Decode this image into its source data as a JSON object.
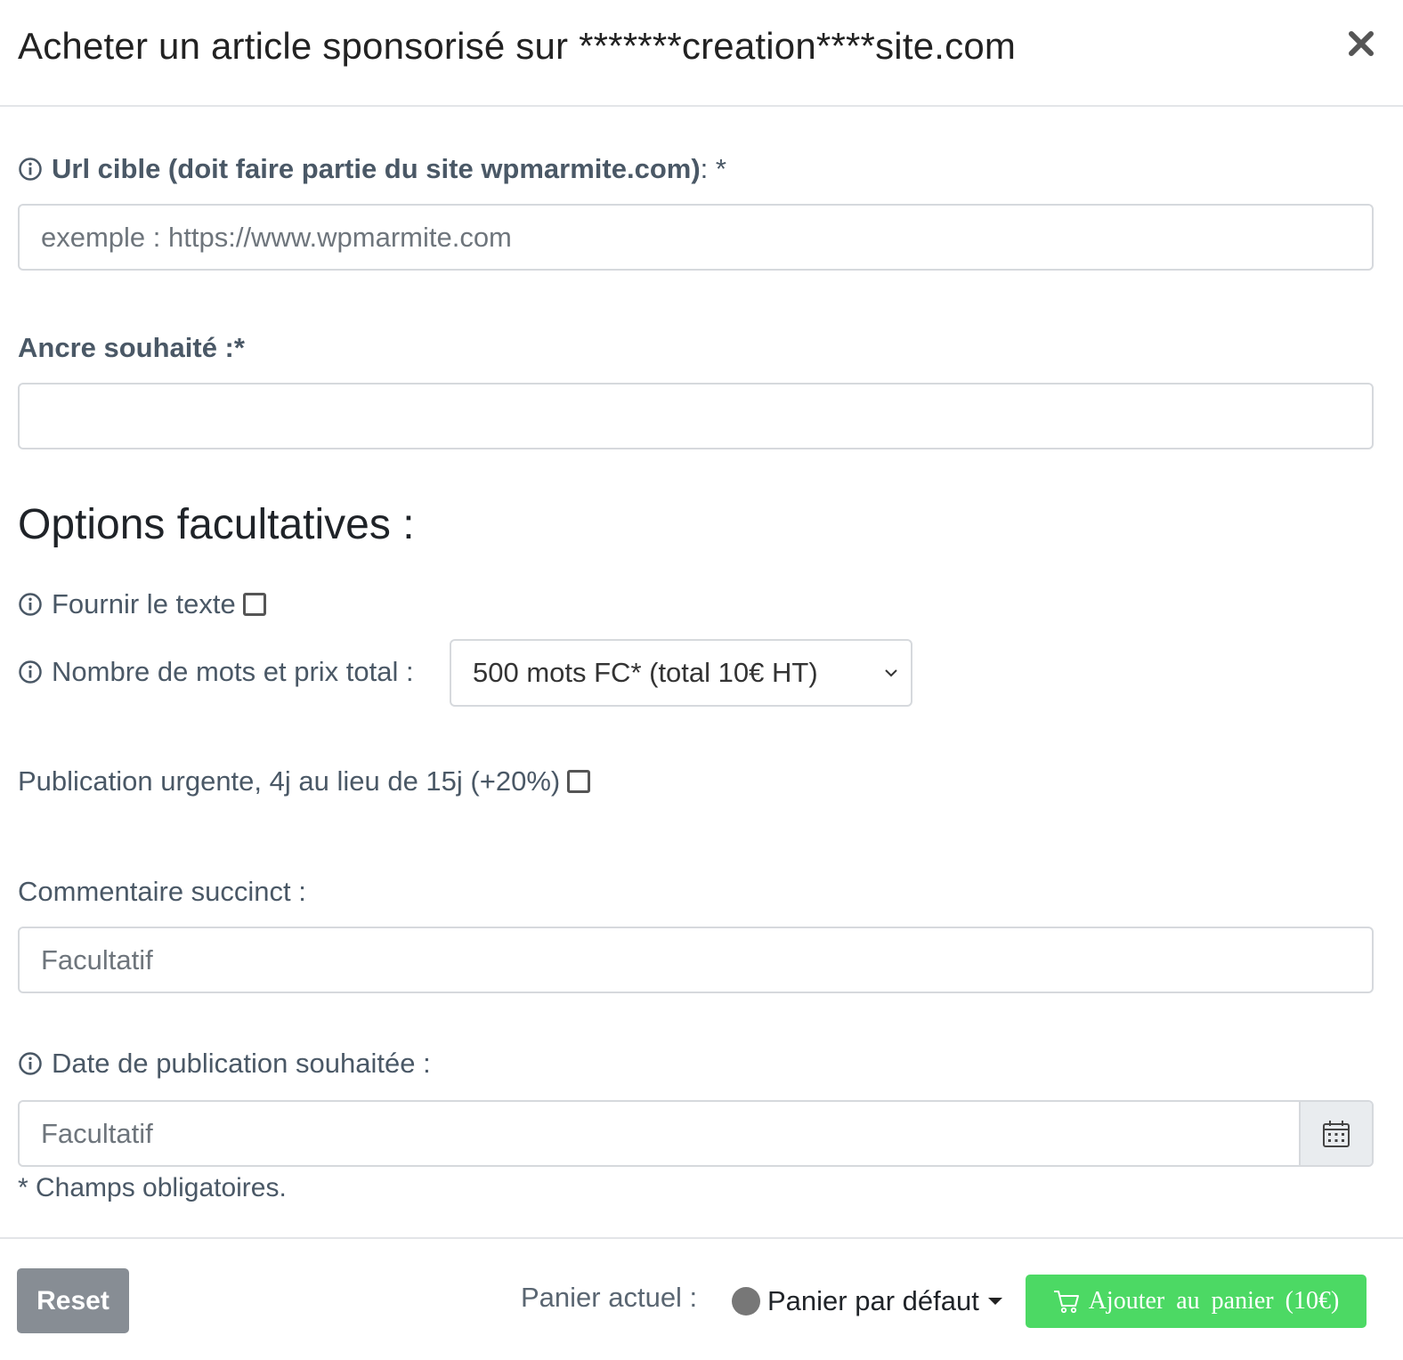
{
  "modal": {
    "title": "Acheter un article sponsorisé sur *******creation****site.com"
  },
  "form": {
    "url_label": "Url cible (doit faire partie du site wpmarmite.com)",
    "url_label_suffix": " : *",
    "url_placeholder": "exemple : https://www.wpmarmite.com",
    "anchor_label": "Ancre souhaité :",
    "anchor_label_suffix": " *",
    "options_title": "Options facultatives :",
    "provide_text_label": "Fournir le texte",
    "word_count_label": "Nombre de mots et prix total :",
    "word_count_selected": "500 mots FC* (total 10€ HT)",
    "urgent_label": "Publication urgente, 4j au lieu de 15j (+20%)",
    "comment_label": "Commentaire succinct :",
    "comment_placeholder": "Facultatif",
    "date_label": "Date de publication souhaitée :",
    "date_placeholder": "Facultatif",
    "required_note": "* Champs obligatoires."
  },
  "footer": {
    "reset_label": "Reset",
    "cart_label": "Panier actuel :",
    "cart_selected": "Panier par défaut",
    "add_to_cart_label": "Ajouter au panier (10€)"
  },
  "colors": {
    "add_button": "#4cd964",
    "reset_button": "#878d94",
    "label_text": "#4a5866"
  }
}
